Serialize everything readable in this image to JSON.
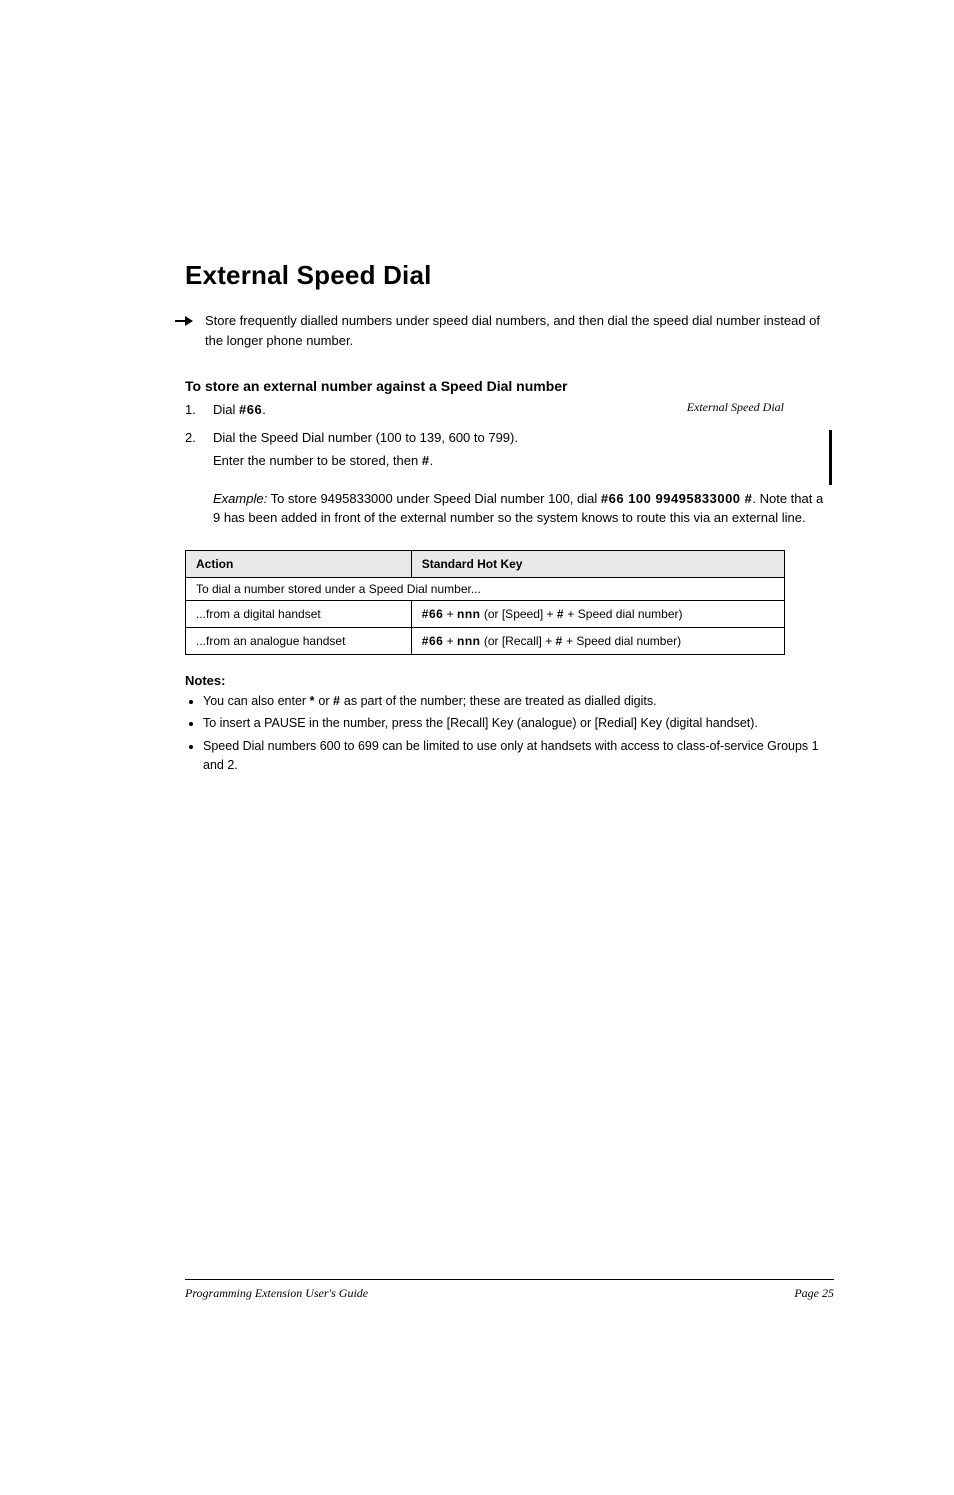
{
  "running_head": "External Speed Dial",
  "section": {
    "title": "External Speed Dial",
    "lead": "Store frequently dialled numbers under speed dial numbers, and then dial the speed dial number instead of the longer phone number."
  },
  "store": {
    "heading": "To store an external number against a Speed Dial number",
    "steps": [
      {
        "prefix": "Dial ",
        "kbd1": "#66",
        "rest": "."
      },
      {
        "prefix": "Dial the Speed Dial number (100 to 139, 600 to 799).",
        "sub_prefix": "Enter the number to be stored, then ",
        "kbd1": "#",
        "sub_after": "."
      }
    ],
    "example_label": "Example:",
    "example_text_1": "To store 9495833000 under Speed Dial number 100, dial ",
    "example_kbd": "#66   100   99495833000   #",
    "example_text_2": ". Note that a 9 has been added in front of the external number so the system knows to route this via an external line."
  },
  "table": {
    "cols": [
      "Action",
      "Standard Hot Key"
    ],
    "span_row": "To dial a number stored under a Speed Dial number...",
    "rows": [
      {
        "action": "...from a digital handset",
        "prefix": "",
        "kbd1": "#66",
        "between": " + ",
        "kbd2": "nnn",
        "after1": " (or [Speed] + ",
        "kbd3": "#",
        "after2": " + Speed dial number)"
      },
      {
        "action": "...from an analogue handset",
        "prefix": "",
        "kbd1": "#66",
        "between": " + ",
        "kbd2": "nnn",
        "after1": " (or [Recall] + ",
        "kbd3": "#",
        "after2": " + Speed dial number)"
      }
    ]
  },
  "notes": {
    "heading": "Notes:",
    "items": [
      {
        "pre": "You can also enter ",
        "kbd": "*",
        "mid1": " or ",
        "kbd2": "#",
        "mid2": " as part of the number; these are treated as dialled digits."
      },
      {
        "pre": "To insert a PAUSE in the number, press the [Recall] Key (analogue) or [Redial] Key (digital handset).",
        "kbd": "",
        "mid1": "",
        "kbd2": "",
        "mid2": ""
      },
      {
        "pre": "Speed Dial numbers 600 to 699 can be limited to use only at handsets with access to class-of-service Groups 1 and 2.",
        "kbd": "",
        "mid1": "",
        "kbd2": "",
        "mid2": ""
      }
    ]
  },
  "footer": {
    "left": "Programming Extension User's Guide",
    "right": "Page 25"
  }
}
